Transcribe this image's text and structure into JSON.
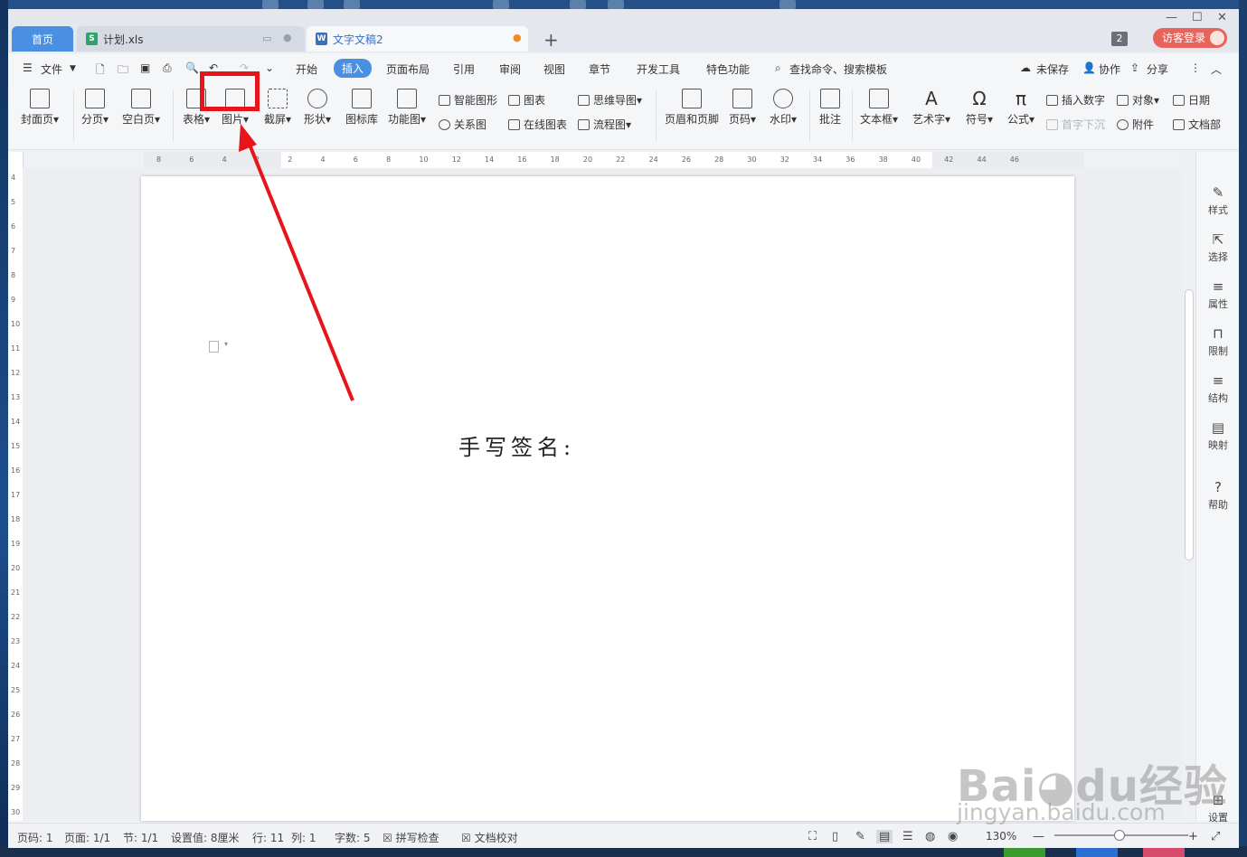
{
  "tabs": {
    "home": "首页",
    "xls": "计划.xls",
    "doc": "文字文稿2",
    "add": "+"
  },
  "header": {
    "badge": "2",
    "login": "访客登录"
  },
  "menu": {
    "file": "文件",
    "items": [
      "开始",
      "插入",
      "页面布局",
      "引用",
      "审阅",
      "视图",
      "章节",
      "开发工具",
      "特色功能"
    ],
    "search": "查找命令、搜索模板",
    "unsaved": "未保存",
    "collab": "协作",
    "share": "分享"
  },
  "ribbon": {
    "cover": "封面页",
    "pagebreak": "分页",
    "blank": "空白页",
    "table": "表格",
    "picture": "图片",
    "screenshot": "截屏",
    "shape": "形状",
    "iconlib": "图标库",
    "funcmap": "功能图",
    "smartart": "智能图形",
    "chart": "图表",
    "mindmap": "思维导图",
    "relation": "关系图",
    "onlinechart": "在线图表",
    "flowchart": "流程图",
    "headerfooter": "页眉和页脚",
    "pagenum": "页码",
    "watermark": "水印",
    "comment": "批注",
    "textbox": "文本框",
    "wordart": "艺术字",
    "symbol": "符号",
    "formula": "公式",
    "insertnum": "插入数字",
    "dropcap": "首字下沉",
    "object": "对象",
    "attachment": "附件",
    "date": "日期",
    "docpart": "文档部"
  },
  "ruler": {
    "h": [
      "8",
      "6",
      "4",
      "2",
      "2",
      "4",
      "6",
      "8",
      "10",
      "12",
      "14",
      "16",
      "18",
      "20",
      "22",
      "24",
      "26",
      "28",
      "30",
      "32",
      "34",
      "36",
      "38",
      "40",
      "42",
      "44",
      "46"
    ],
    "v": [
      "4",
      "5",
      "6",
      "7",
      "8",
      "9",
      "10",
      "11",
      "12",
      "13",
      "14",
      "15",
      "16",
      "17",
      "18",
      "19",
      "20",
      "21",
      "22",
      "23",
      "24",
      "25",
      "26",
      "27",
      "28",
      "29",
      "30"
    ]
  },
  "document": {
    "text": "手写签名:"
  },
  "rightpanel": {
    "style": "样式",
    "select": "选择",
    "props": "属性",
    "limit": "限制",
    "structure": "结构",
    "mapping": "映射",
    "help": "帮助",
    "settings": "设置"
  },
  "status": {
    "pagenum": "页码: 1",
    "pages": "页面: 1/1",
    "section": "节: 1/1",
    "setting": "设置值: 8厘米",
    "row": "行: 11",
    "col": "列: 1",
    "words": "字数: 5",
    "spell": "拼写检查",
    "proof": "文档校对",
    "zoom": "130%"
  },
  "watermark": {
    "brand": "Bai",
    "brand2": "du",
    "cn": "经验",
    "url": "jingyan.baidu.com"
  },
  "colors": {
    "accent": "#4a90e2",
    "highlight": "#e8141b",
    "login": "#e8645a"
  }
}
